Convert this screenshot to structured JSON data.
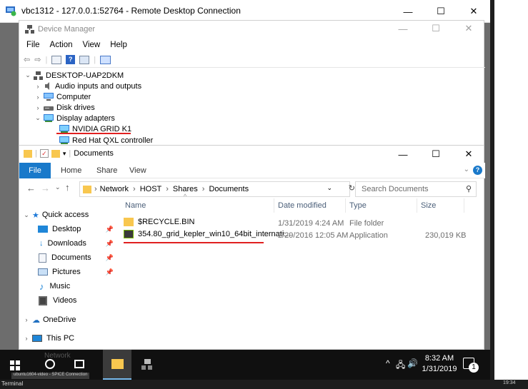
{
  "rdc": {
    "title": "vbc1312 - 127.0.0.1:52764 - Remote Desktop Connection"
  },
  "device_manager": {
    "title": "Device Manager",
    "menu": [
      "File",
      "Action",
      "View",
      "Help"
    ],
    "tree": {
      "root": "DESKTOP-UAP2DKM",
      "items": [
        "Audio inputs and outputs",
        "Computer",
        "Disk drives",
        "Display adapters"
      ],
      "display_children": [
        "NVIDIA GRID K1",
        "Red Hat QXL controller"
      ]
    }
  },
  "explorer": {
    "title": "Documents",
    "ribbon": {
      "file": "File",
      "tabs": [
        "Home",
        "Share",
        "View"
      ]
    },
    "address": {
      "parts": [
        "Network",
        "HOST",
        "Shares",
        "Documents"
      ]
    },
    "search_placeholder": "Search Documents",
    "nav": {
      "quick_access": "Quick access",
      "items": [
        "Desktop",
        "Downloads",
        "Documents",
        "Pictures",
        "Music",
        "Videos"
      ],
      "onedrive": "OneDrive",
      "this_pc": "This PC",
      "network": "Network"
    },
    "columns": {
      "name": "Name",
      "date": "Date modified",
      "type": "Type",
      "size": "Size"
    },
    "files": [
      {
        "name": "$RECYCLE.BIN",
        "date": "1/31/2019 4:24 AM",
        "type": "File folder",
        "size": ""
      },
      {
        "name": "354.80_grid_kepler_win10_64bit_internati...",
        "date": "2/29/2016 12:05 AM",
        "type": "Application",
        "size": "230,019 KB"
      }
    ]
  },
  "taskbar": {
    "time": "8:32 AM",
    "date": "1/31/2019",
    "notification_count": "1"
  },
  "outer_taskbar": {
    "app_label": "ubuntu1604-video - SPICE Connection",
    "terminal": "Terminal",
    "time": "19:34"
  }
}
